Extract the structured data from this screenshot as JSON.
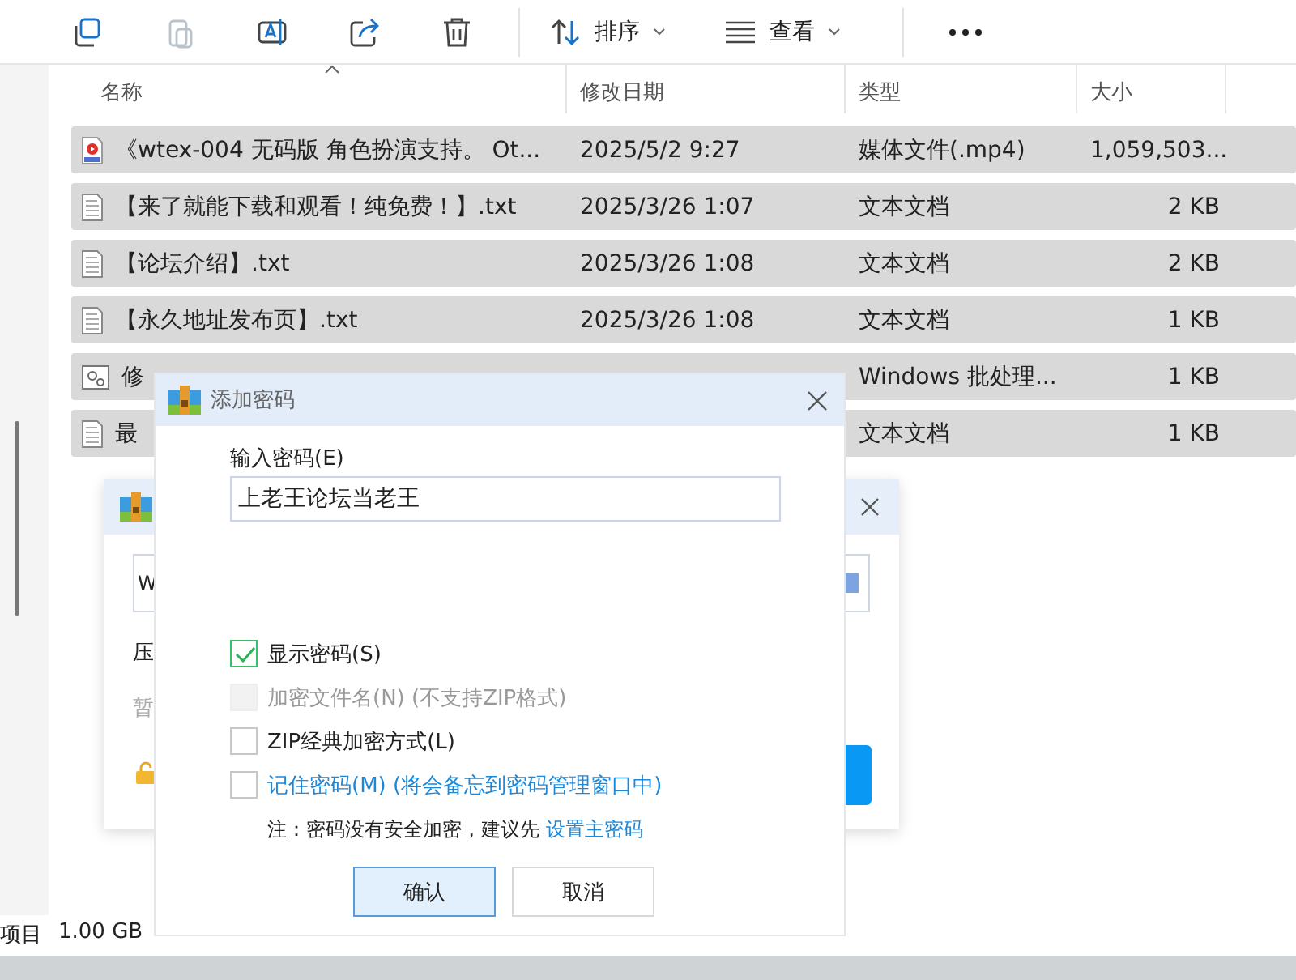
{
  "toolbar": {
    "buttons": [
      {
        "kind": "copy",
        "disabled": false
      },
      {
        "kind": "paste",
        "disabled": true
      },
      {
        "kind": "rename",
        "disabled": false
      },
      {
        "kind": "share",
        "disabled": false
      },
      {
        "kind": "delete",
        "disabled": false
      }
    ],
    "sort_label": "排序",
    "view_label": "查看"
  },
  "columns": [
    "名称",
    "修改日期",
    "类型",
    "大小"
  ],
  "rows": [
    {
      "kind": "video",
      "name": "《wtex-004 无码版 角色扮演支持。 Ot...",
      "date": "2025/5/2 9:27",
      "type": "媒体文件(.mp4)",
      "size": "1,059,503...",
      "selected": true
    },
    {
      "kind": "text",
      "name": "【来了就能下载和观看！纯免费！】.txt",
      "date": "2025/3/26 1:07",
      "type": "文本文档",
      "size": "2 KB",
      "selected": true
    },
    {
      "kind": "text",
      "name": "【论坛介绍】.txt",
      "date": "2025/3/26 1:08",
      "type": "文本文档",
      "size": "2 KB",
      "selected": true
    },
    {
      "kind": "text",
      "name": "【永久地址发布页】.txt",
      "date": "2025/3/26 1:08",
      "type": "文本文档",
      "size": "1 KB",
      "selected": true
    },
    {
      "kind": "script",
      "name": "修",
      "type": "Windows 批处理...",
      "size": "1 KB",
      "selected": true
    },
    {
      "kind": "text",
      "name": "最",
      "type": "文本文档",
      "size": "1 KB",
      "selected": true
    }
  ],
  "status_bar": {
    "count": "项目",
    "size": "1.00 GB"
  },
  "back_dialog": {
    "field_value": "W",
    "label_1": "压",
    "label_2": "暂"
  },
  "dialog": {
    "title": "添加密码",
    "password_label": "输入密码(E)",
    "password": "上老王论坛当老王",
    "options": [
      {
        "kind": "plain",
        "label": "显示密码(S)",
        "checked": true,
        "disabled": false
      },
      {
        "kind": "plain",
        "label": "加密文件名(N) (不支持ZIP格式)",
        "checked": false,
        "disabled": true
      },
      {
        "kind": "plain",
        "label": "ZIP经典加密方式(L)",
        "checked": false,
        "disabled": false
      },
      {
        "kind": "link",
        "label": "记住密码(M) (将会备忘到密码管理窗口中)",
        "checked": false,
        "disabled": false
      }
    ],
    "note": "注：密码没有安全加密，建议先",
    "note_link": "设置主密码",
    "buttons": [
      {
        "label": "确认",
        "primary": true
      },
      {
        "label": "取消",
        "primary": false
      }
    ]
  }
}
